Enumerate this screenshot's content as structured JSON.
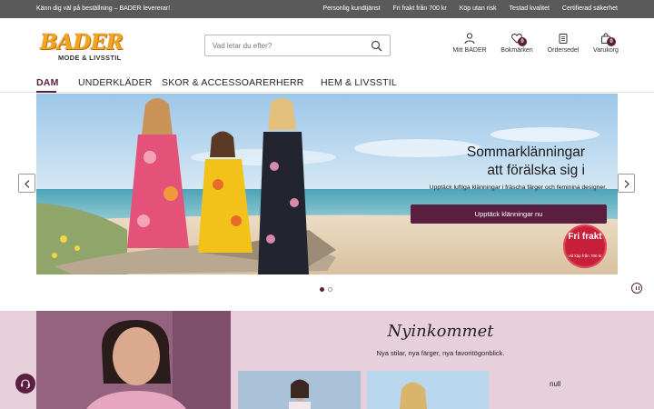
{
  "topbar": {
    "welcome": "Känn dig väl på beställning – BADER levererar!",
    "links": [
      "Personlig kundtjänst",
      "Fri frakt från 700 kr",
      "Köp utan risk",
      "Testad kvalitet",
      "Certifierad säkerhet"
    ]
  },
  "logo": {
    "word": "BADER",
    "tagline": "MODE & LIVSSTIL"
  },
  "search": {
    "placeholder": "Vad letar du efter?"
  },
  "header_icons": {
    "account": "Mitt BADER",
    "wishlist": "Bokmärken",
    "wishlist_count": "0",
    "orders": "Ordersedel",
    "cart": "Varukorg",
    "cart_count": "0"
  },
  "nav": [
    "DAM",
    "UNDERKLÄDER",
    "SKOR & ACCESSOARER",
    "HERR",
    "HEM & LIVSSTIL"
  ],
  "hero": {
    "title_line1": "Sommarklänningar",
    "title_line2": "att förälska sig i",
    "subtitle": "Upptäck luftiga klänningar i fräscha färger och feminina designer.",
    "cta": "Upptäck klänningar nu",
    "stamp_big": "Fri frakt",
    "stamp_small": "vid köp från 700 kr"
  },
  "carousel": {
    "slides": 2,
    "active": 1
  },
  "promo": {
    "title": "Nyinkommet",
    "subtitle": "Nya stilar, nya färger, nya favoritögonblick.",
    "null_text": "null"
  },
  "colors": {
    "brand": "#5a1e3f",
    "topbar": "#5a5a5a",
    "promo_bg": "#e8cfdc",
    "logo": "#f3a51b",
    "stamp": "#c8203a"
  }
}
